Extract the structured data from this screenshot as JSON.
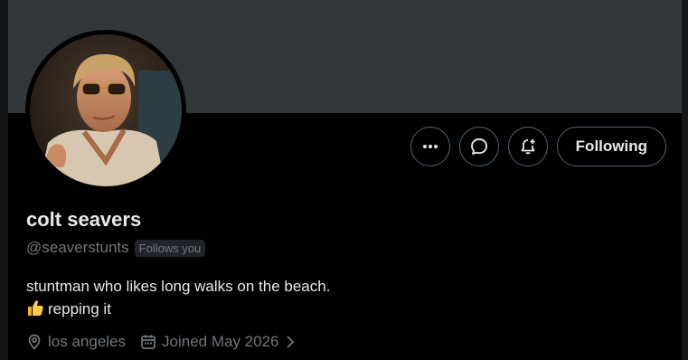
{
  "profile": {
    "display_name": "colt seavers",
    "handle": "@seaverstunts",
    "follows_you_badge": "Follows you",
    "bio_line1": "stuntman who likes long walks on the beach.",
    "bio_line2": "repping it",
    "bio_emoji": "thumbs-up",
    "location": "los angeles",
    "joined": "Joined May 2026"
  },
  "actions": {
    "more_icon": "more-horizontal-icon",
    "message_icon": "message-bubble-icon",
    "notify_icon": "bell-plus-icon",
    "following_label": "Following"
  },
  "meta_icons": {
    "location": "location-pin-icon",
    "joined": "calendar-icon",
    "expand": "chevron-right-icon"
  },
  "colors": {
    "banner": "#333639",
    "background": "#000000",
    "primary_text": "#e7e9ea",
    "secondary_text": "#71767b",
    "border": "#536471"
  }
}
